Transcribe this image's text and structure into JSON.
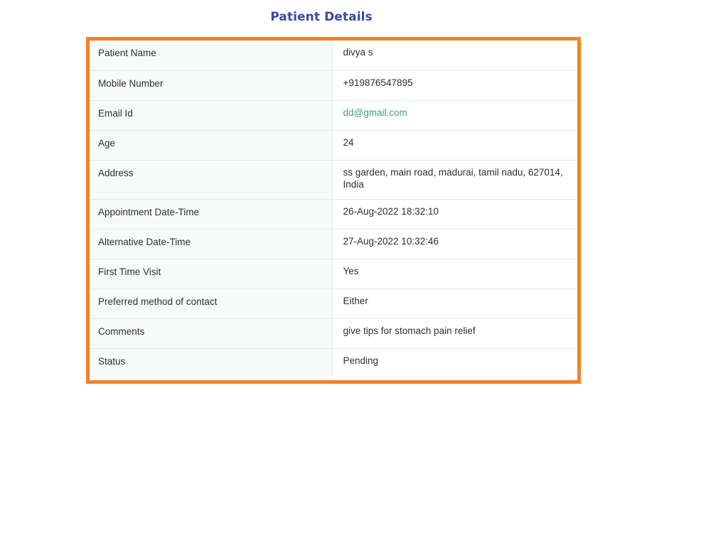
{
  "page": {
    "title": "Patient Details"
  },
  "colors": {
    "title": "#3b47a8",
    "frame_border": "#f08228",
    "email_link": "#3f9c8a"
  },
  "details": {
    "patient_name": {
      "label": "Patient Name",
      "value": "divya s"
    },
    "mobile_number": {
      "label": "Mobile Number",
      "value": "+919876547895"
    },
    "email_id": {
      "label": "Email Id",
      "value": "dd@gmail.com"
    },
    "age": {
      "label": "Age",
      "value": "24"
    },
    "address": {
      "label": "Address",
      "value": "ss garden, main road, madurai, tamil nadu, 627014, India"
    },
    "appointment_datetime": {
      "label": "Appointment Date-Time",
      "value": "26-Aug-2022 18:32:10"
    },
    "alternative_datetime": {
      "label": "Alternative Date-Time",
      "value": "27-Aug-2022 10:32:46"
    },
    "first_time_visit": {
      "label": "First Time Visit",
      "value": "Yes"
    },
    "preferred_contact": {
      "label": "Preferred method of contact",
      "value": "Either"
    },
    "comments": {
      "label": "Comments",
      "value": "give tips for stomach pain relief"
    },
    "status": {
      "label": "Status",
      "value": "Pending"
    }
  }
}
